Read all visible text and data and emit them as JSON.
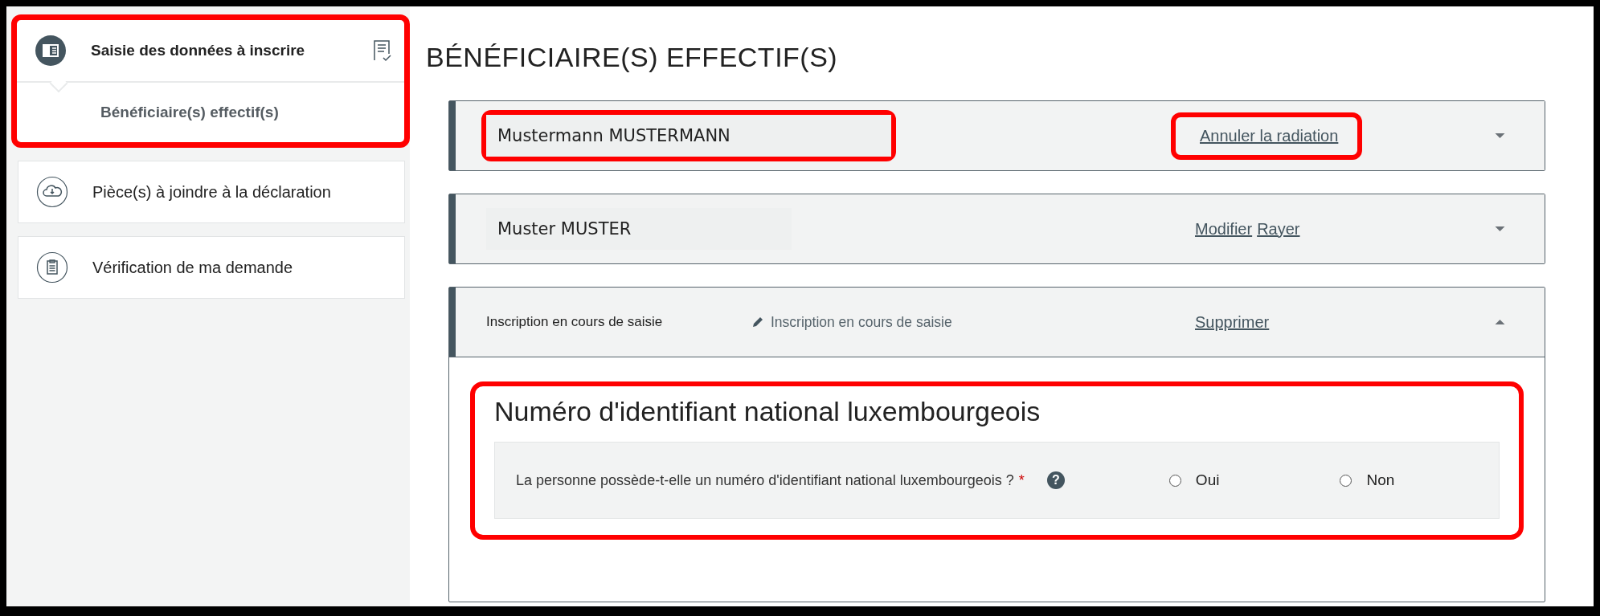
{
  "sidebar": {
    "items": [
      {
        "kind": "entry",
        "label": "Saisie des données à inscrire",
        "selected": true,
        "highlighted": true,
        "children": [
          {
            "label": "Bénéficiaire(s) effectif(s)",
            "selected": true
          }
        ]
      },
      {
        "kind": "upload",
        "label": "Pièce(s) à joindre à la déclaration",
        "selected": false,
        "highlighted": false
      },
      {
        "kind": "review",
        "label": "Vérification de ma demande",
        "selected": false,
        "highlighted": false
      }
    ]
  },
  "page_title": "BÉNÉFICIAIRE(S) EFFECTIF(S)",
  "cards": [
    {
      "kind": "person",
      "name": "Mustermann MUSTERMANN",
      "name_highlighted": true,
      "actions": [
        {
          "label": "Annuler la radiation",
          "highlighted": true
        }
      ],
      "expanded": false
    },
    {
      "kind": "person",
      "name": "Muster MUSTER",
      "name_highlighted": false,
      "actions": [
        {
          "label": "Modifier",
          "highlighted": false
        },
        {
          "label": "Rayer",
          "highlighted": false
        }
      ],
      "expanded": false
    },
    {
      "kind": "draft",
      "name": "Inscription en cours de saisie",
      "name_highlighted": false,
      "status": "Inscription en cours de saisie",
      "actions": [
        {
          "label": "Supprimer",
          "highlighted": false
        }
      ],
      "expanded": true,
      "section": {
        "title": "Numéro d'identifiant national luxembourgeois",
        "highlighted": true,
        "question": "La personne possède-t-elle un numéro d'identifiant national luxembourgeois ?",
        "required_mark": "*",
        "help": "?",
        "options": [
          {
            "label": "Oui",
            "selected": false
          },
          {
            "label": "Non",
            "selected": false
          }
        ]
      }
    }
  ]
}
